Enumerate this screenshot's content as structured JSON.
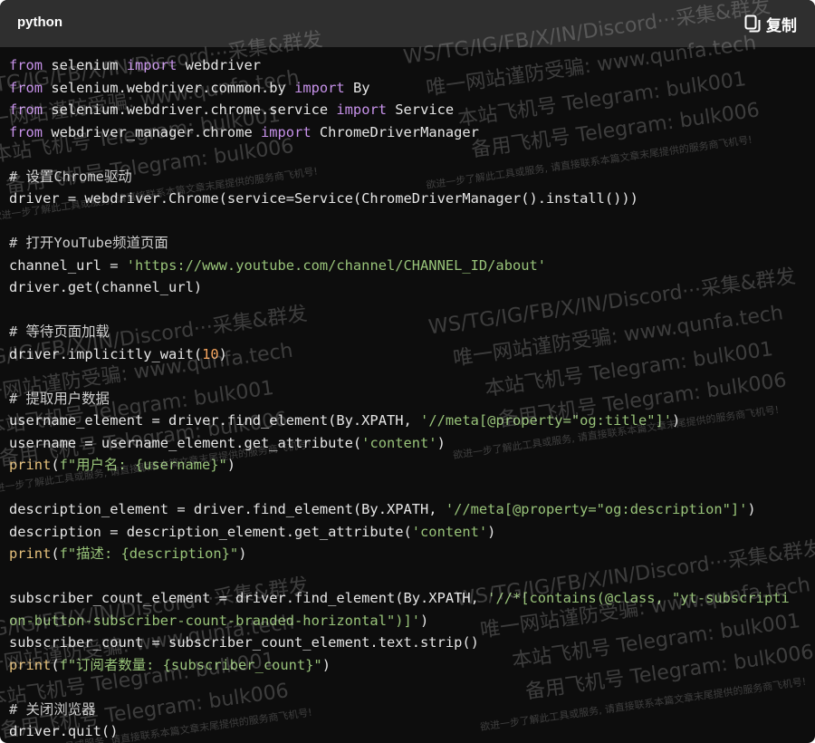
{
  "header": {
    "language": "python",
    "copy_label": "复制"
  },
  "colors": {
    "background": "#0d0d0d",
    "header": "#2f2f2f",
    "keyword": "#c792ea",
    "string": "#98c379",
    "number": "#f5a45d"
  },
  "code": {
    "lines": [
      [
        [
          "kw",
          "from"
        ],
        [
          "t",
          " selenium "
        ],
        [
          "kw",
          "import"
        ],
        [
          "t",
          " webdriver"
        ]
      ],
      [
        [
          "kw",
          "from"
        ],
        [
          "t",
          " selenium.webdriver.common.by "
        ],
        [
          "kw",
          "import"
        ],
        [
          "t",
          " By"
        ]
      ],
      [
        [
          "kw",
          "from"
        ],
        [
          "t",
          " selenium.webdriver.chrome.service "
        ],
        [
          "kw",
          "import"
        ],
        [
          "t",
          " Service"
        ]
      ],
      [
        [
          "kw",
          "from"
        ],
        [
          "t",
          " webdriver_manager.chrome "
        ],
        [
          "kw",
          "import"
        ],
        [
          "t",
          " ChromeDriverManager"
        ]
      ],
      [],
      [
        [
          "cm",
          "# 设置Chrome驱动"
        ]
      ],
      [
        [
          "t",
          "driver = webdriver.Chrome(service=Service(ChromeDriverManager().install()))"
        ]
      ],
      [],
      [
        [
          "cm",
          "# 打开YouTube频道页面"
        ]
      ],
      [
        [
          "t",
          "channel_url = "
        ],
        [
          "str",
          "'https://www.youtube.com/channel/CHANNEL_ID/about'"
        ]
      ],
      [
        [
          "t",
          "driver.get(channel_url)"
        ]
      ],
      [],
      [
        [
          "cm",
          "# 等待页面加载"
        ]
      ],
      [
        [
          "t",
          "driver.implicitly_wait("
        ],
        [
          "num",
          "10"
        ],
        [
          "t",
          ")"
        ]
      ],
      [],
      [
        [
          "cm",
          "# 提取用户数据"
        ]
      ],
      [
        [
          "t",
          "username_element = driver.find_element(By.XPATH, "
        ],
        [
          "str",
          "'//meta[@property=\"og:title\"]'"
        ],
        [
          "t",
          ")"
        ]
      ],
      [
        [
          "t",
          "username = username_element.get_attribute("
        ],
        [
          "str",
          "'content'"
        ],
        [
          "t",
          ")"
        ]
      ],
      [
        [
          "fn",
          "print"
        ],
        [
          "t",
          "("
        ],
        [
          "str",
          "f\"用户名: {username}\""
        ],
        [
          "t",
          ")"
        ]
      ],
      [],
      [
        [
          "t",
          "description_element = driver.find_element(By.XPATH, "
        ],
        [
          "str",
          "'//meta[@property=\"og:description\"]'"
        ],
        [
          "t",
          ")"
        ]
      ],
      [
        [
          "t",
          "description = description_element.get_attribute("
        ],
        [
          "str",
          "'content'"
        ],
        [
          "t",
          ")"
        ]
      ],
      [
        [
          "fn",
          "print"
        ],
        [
          "t",
          "("
        ],
        [
          "str",
          "f\"描述: {description}\""
        ],
        [
          "t",
          ")"
        ]
      ],
      [],
      [
        [
          "t",
          "subscriber_count_element = driver.find_element(By.XPATH, "
        ],
        [
          "str",
          "'//*[contains(@class, \"yt-subscripti"
        ]
      ],
      [
        [
          "str",
          "on-button-subscriber-count-branded-horizontal\")]'"
        ],
        [
          "t",
          ")"
        ]
      ],
      [
        [
          "t",
          "subscriber_count = subscriber_count_element.text.strip()"
        ]
      ],
      [
        [
          "fn",
          "print"
        ],
        [
          "t",
          "("
        ],
        [
          "str",
          "f\"订阅者数量: {subscriber_count}\""
        ],
        [
          "t",
          ")"
        ]
      ],
      [],
      [
        [
          "cm",
          "# 关闭浏览器"
        ]
      ],
      [
        [
          "t",
          "driver.quit()"
        ]
      ]
    ]
  },
  "watermark": {
    "lines": [
      "WS/TG/IG/FB/X/IN/Discord···采集&群发",
      "唯一网站谨防受骗: www.qunfa.tech",
      "本站飞机号 Telegram: bulk001",
      "备用飞机号 Telegram: bulk006",
      "欲进一步了解此工具或服务, 请直接联系本篇文章末尾提供的服务商飞机号!"
    ]
  }
}
